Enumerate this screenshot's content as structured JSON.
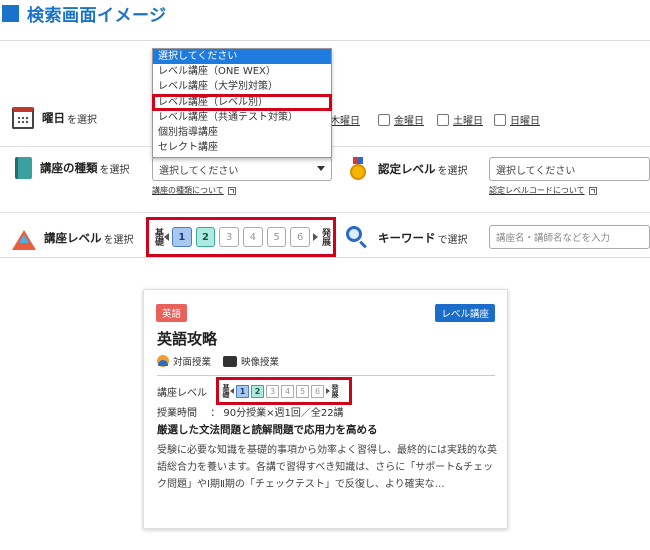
{
  "page_title": "検索画面イメージ",
  "filters": {
    "day": {
      "label_bold": "曜日",
      "label_suffix": "を選択",
      "days": [
        "木曜日",
        "金曜日",
        "土曜日",
        "日曜日"
      ]
    },
    "course_type": {
      "label_bold": "講座の種類",
      "label_suffix": "を選択",
      "select_value": "選択してください",
      "help_link": "講座の種類について",
      "dropdown_options": [
        "選択してください",
        "レベル講座（ONE WEX）",
        "レベル講座（大学別対策）",
        "レベル講座（レベル別）",
        "レベル講座（共通テスト対策）",
        "個別指導講座",
        "セレクト講座"
      ],
      "dropdown_selected_index": 0,
      "dropdown_highlight_index": 3
    },
    "certified_level": {
      "label_bold": "認定レベル",
      "label_suffix": "を選択",
      "select_value": "選択してください",
      "help_link": "認定レベルコードについて"
    },
    "course_level": {
      "label_bold": "講座レベル",
      "label_suffix": "を選択",
      "left_label": "基礎",
      "right_label": "発展",
      "levels": [
        "1",
        "2",
        "3",
        "4",
        "5",
        "6"
      ],
      "active_levels": [
        "1",
        "2"
      ]
    },
    "keyword": {
      "label_bold": "キーワード",
      "label_suffix": "で選択",
      "placeholder": "講座名・講師名などを入力"
    }
  },
  "card": {
    "subject_badge": "英語",
    "type_badge": "レベル講座",
    "title": "英語攻略",
    "modes": [
      "対面授業",
      "映像授業"
    ],
    "level_label": "講座レベル",
    "level_left": "基礎",
    "level_right": "発展",
    "levels": [
      "1",
      "2",
      "3",
      "4",
      "5",
      "6"
    ],
    "hours_label": "授業時間",
    "hours_value": "：  90分授業×週1回／全22講",
    "headline": "厳選した文法問題と読解問題で応用力を高める",
    "description": "受験に必要な知識を基礎的事項から効率よく習得し、最終的には実践的な英語総合力を養います。各講で習得すべき知識は、さらに「サポート&チェック問題」やⅠ期Ⅱ期の「チェックテスト」で反復し、より確実な…"
  },
  "colors": {
    "accent_blue": "#1a73c9",
    "highlight_red": "#d0021b",
    "level_1": "#a9c8f0",
    "level_2": "#aeeadf",
    "badge_subject": "#e8615b",
    "badge_type": "#1a6dc9"
  },
  "icons": [
    "calendar-icon",
    "book-icon",
    "medal-icon",
    "pyramid-icon",
    "magnifier-icon",
    "person-icon",
    "camera-icon",
    "external-link-icon"
  ]
}
